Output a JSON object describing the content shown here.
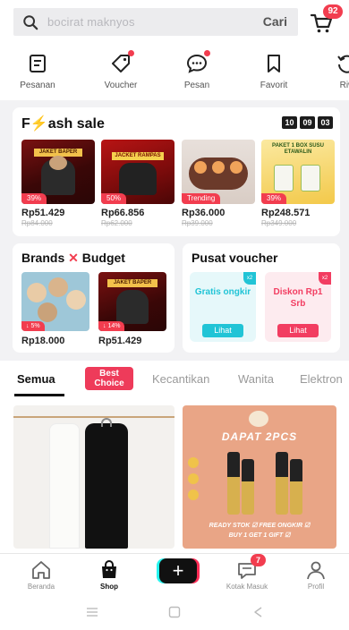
{
  "search": {
    "placeholder": "bocirat maknyos",
    "button_label": "Cari"
  },
  "cart": {
    "badge": "92"
  },
  "shortcuts": [
    {
      "label": "Pesanan",
      "icon": "orders-icon"
    },
    {
      "label": "Voucher",
      "icon": "voucher-icon"
    },
    {
      "label": "Pesan",
      "icon": "chat-icon"
    },
    {
      "label": "Favorit",
      "icon": "bookmark-icon"
    },
    {
      "label": "Riw",
      "icon": "history-icon"
    }
  ],
  "flash_sale": {
    "title_prefix": "F",
    "title_bolt": "⚡",
    "title_rest": "ash sale",
    "timer": [
      "10",
      "09",
      "03"
    ],
    "products": [
      {
        "discount": "39%",
        "price": "Rp51.429",
        "old_price": "Rp84.000",
        "image_text": "JAKET BAPER"
      },
      {
        "discount": "50%",
        "price": "Rp66.856",
        "old_price": "Rp62.000",
        "image_text": "JACKET RAMPAS"
      },
      {
        "discount": "Trending",
        "price": "Rp36.000",
        "old_price": "Rp39.000",
        "image_text": ""
      },
      {
        "discount": "39%",
        "price": "Rp248.571",
        "old_price": "Rp349.000",
        "image_text": "PAKET 1 BOX SUSU ETAWALIN"
      }
    ]
  },
  "brands_budget": {
    "title_left": "Brands",
    "title_x": "✕",
    "title_right": "Budget",
    "products": [
      {
        "discount": "5%",
        "price": "Rp18.000"
      },
      {
        "discount": "14%",
        "price": "Rp51.429",
        "image_text": "JAKET BAPER"
      }
    ]
  },
  "pusat_voucher": {
    "title": "Pusat voucher",
    "vouchers": [
      {
        "text": "Gratis ongkir",
        "button": "Lihat",
        "corner": "x2"
      },
      {
        "text": "Diskon Rp1 Srb",
        "button": "Lihat",
        "corner": "x2"
      }
    ]
  },
  "tabs": {
    "items": [
      "Semua",
      "Kecantikan",
      "Wanita",
      "Elektron"
    ],
    "best_choice_line1": "Best",
    "best_choice_line2": "Choice"
  },
  "feed": {
    "promo_banner_top": "DAPAT 2PCS",
    "promo_banner_bottom_1": "READY STOK ☑ FREE ONGKIR ☑",
    "promo_banner_bottom_2": "BUY 1 GET 1 GIFT ☑"
  },
  "bottom_nav": {
    "items": [
      {
        "label": "Beranda",
        "icon": "home-icon"
      },
      {
        "label": "Shop",
        "icon": "shop-bag-icon"
      },
      {
        "label": "",
        "icon": "plus-icon"
      },
      {
        "label": "Kotak Masuk",
        "icon": "inbox-icon"
      },
      {
        "label": "Profil",
        "icon": "profile-icon"
      }
    ],
    "inbox_badge": "7"
  },
  "colors": {
    "brand_red": "#f23d4f",
    "voucher_teal": "#21c4d6",
    "voucher_pink": "#f23d61"
  }
}
